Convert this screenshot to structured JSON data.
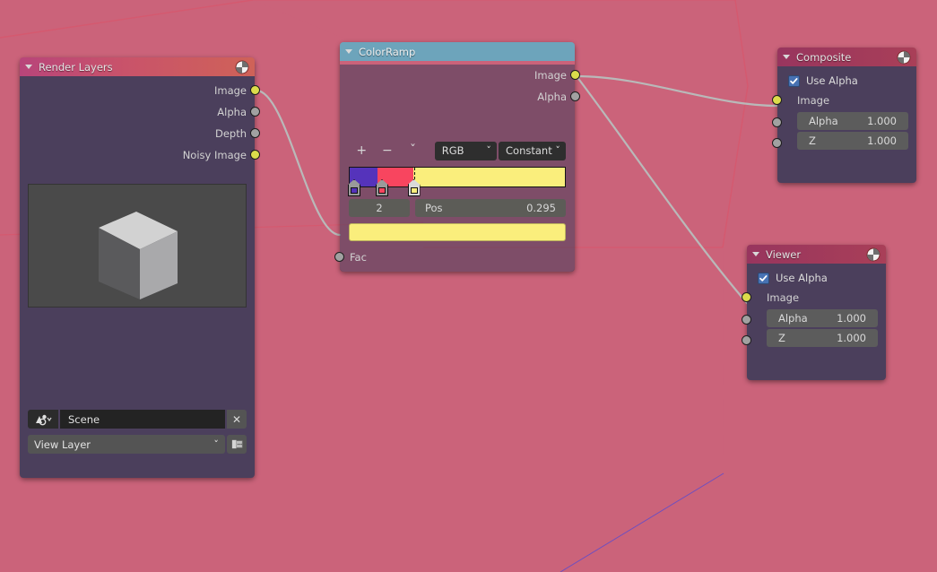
{
  "editor": {
    "background_color": "#5639b3",
    "backdrop_yellow": "#ccc469",
    "backdrop_pink": "#cb637a"
  },
  "nodes": {
    "render_layers": {
      "title": "Render Layers",
      "header_icon": "compositor-node-icon",
      "collapse_icon": "triangle-down-icon",
      "outputs": [
        {
          "label": "Image",
          "type": "color",
          "connected": true
        },
        {
          "label": "Alpha",
          "type": "value",
          "connected": false
        },
        {
          "label": "Depth",
          "type": "value",
          "connected": false
        },
        {
          "label": "Noisy Image",
          "type": "color",
          "connected": false
        }
      ],
      "preview": {
        "name": "render-preview",
        "description": "grey cube"
      },
      "scene_field": {
        "icon": "scene-icon",
        "value": "Scene",
        "clear_label": "✕"
      },
      "view_layer_field": {
        "value": "View Layer",
        "chevron": "ˇ",
        "new_button_icon": "new-layer-icon"
      }
    },
    "colorramp": {
      "title": "ColorRamp",
      "header_icon": "",
      "collapse_icon": "triangle-down-icon",
      "outputs": [
        {
          "label": "Image",
          "type": "color",
          "connected": true
        },
        {
          "label": "Alpha",
          "type": "value",
          "connected": false
        }
      ],
      "inputs": [
        {
          "label": "Fac",
          "type": "value",
          "connected": true
        }
      ],
      "controls": {
        "add_label": "+",
        "remove_label": "−",
        "menu_label": "ˇ",
        "color_mode": "RGB",
        "interpolation": "Constant"
      },
      "ramp": {
        "stops": [
          {
            "position": 0.0,
            "color": "#5533bb"
          },
          {
            "position": 0.128,
            "color": "#f8455f"
          },
          {
            "position": 0.295,
            "color": "#faee7c"
          }
        ],
        "selected_index": 2
      },
      "active_stop": {
        "index": "2",
        "pos_label": "Pos",
        "pos_value": "0.295",
        "color": "#faee7c"
      }
    },
    "composite": {
      "title": "Composite",
      "header_icon": "compositor-node-icon",
      "collapse_icon": "triangle-down-icon",
      "use_alpha": {
        "label": "Use Alpha",
        "checked": true
      },
      "inputs": [
        {
          "label": "Image",
          "type": "color",
          "connected": true
        },
        {
          "label": "Alpha",
          "type": "value",
          "value": "1.000",
          "connected": false
        },
        {
          "label": "Z",
          "type": "value",
          "value": "1.000",
          "connected": false
        }
      ]
    },
    "viewer": {
      "title": "Viewer",
      "header_icon": "compositor-node-icon",
      "collapse_icon": "triangle-down-icon",
      "use_alpha": {
        "label": "Use Alpha",
        "checked": true
      },
      "inputs": [
        {
          "label": "Image",
          "type": "color",
          "connected": true
        },
        {
          "label": "Alpha",
          "type": "value",
          "value": "1.000",
          "connected": false
        },
        {
          "label": "Z",
          "type": "value",
          "value": "1.000",
          "connected": false
        }
      ]
    }
  }
}
